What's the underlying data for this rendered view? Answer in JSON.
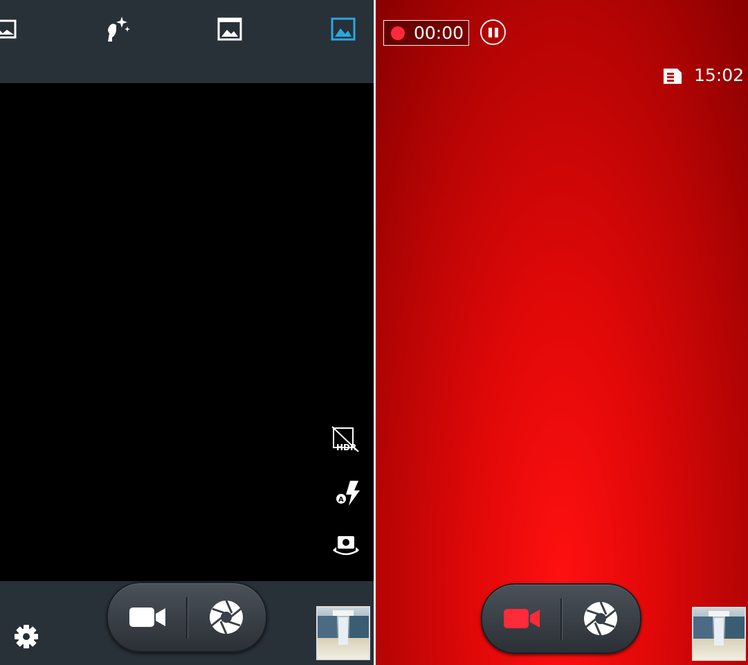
{
  "left_screen": {
    "mode_bar": {
      "modes": [
        {
          "icon": "panorama-icon",
          "selected": false
        },
        {
          "icon": "beauty-face-icon",
          "selected": false
        },
        {
          "icon": "photo-frame-icon",
          "selected": false
        },
        {
          "icon": "landscape-icon",
          "selected": true
        }
      ]
    },
    "side_controls": [
      {
        "icon": "hdr-off-icon",
        "label": "HDR"
      },
      {
        "icon": "flash-auto-icon",
        "label": "A"
      },
      {
        "icon": "switch-camera-icon"
      }
    ],
    "bottom_bar": {
      "settings_icon": "gear-icon",
      "video_icon": "video-camera-icon",
      "shutter_icon": "shutter-icon",
      "gallery_thumbnail": "gallery-thumbnail"
    }
  },
  "right_screen": {
    "recording": {
      "time": "00:00",
      "dot_color": "#ff2a3a"
    },
    "pause_icon": "pause-icon",
    "storage_icon": "sd-card-icon",
    "remaining_time": "15:02",
    "bottom": {
      "video_icon_color": "#ff2a3a",
      "shutter_icon": "shutter-icon",
      "gallery_thumbnail": "gallery-thumbnail"
    }
  },
  "colors": {
    "bar_bg": "#283038",
    "accent_blue": "#2aa8e0",
    "record_red": "#ff2a3a"
  }
}
